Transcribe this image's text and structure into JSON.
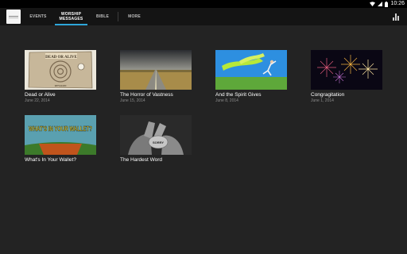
{
  "status_bar": {
    "time": "10:26"
  },
  "nav": {
    "tabs": [
      {
        "label": "EVENTS"
      },
      {
        "label": "WORSHIP\nMESSAGES"
      },
      {
        "label": "BIBLE"
      },
      {
        "label": "MORE"
      }
    ],
    "active_tab": "WORSHIP MESSAGES",
    "accent_color": "#2ea6d9"
  },
  "messages": [
    {
      "title": "Dead or Alive",
      "date": "June 22, 2014",
      "thumb_text": "DEAD OR ALIVE",
      "thumb_caption": "REWARD"
    },
    {
      "title": "The Horror of Vastness",
      "date": "June 15, 2014"
    },
    {
      "title": "And the Spirit Gives",
      "date": "June 8, 2014"
    },
    {
      "title": "Congragitation",
      "date": "June 1, 2014"
    },
    {
      "title": "What's In Your Wallet?",
      "date": "",
      "thumb_text": "WHAT'S IN YOUR WALLET?"
    },
    {
      "title": "The Hardest Word",
      "date": "",
      "thumb_text": "SORRY"
    }
  ]
}
